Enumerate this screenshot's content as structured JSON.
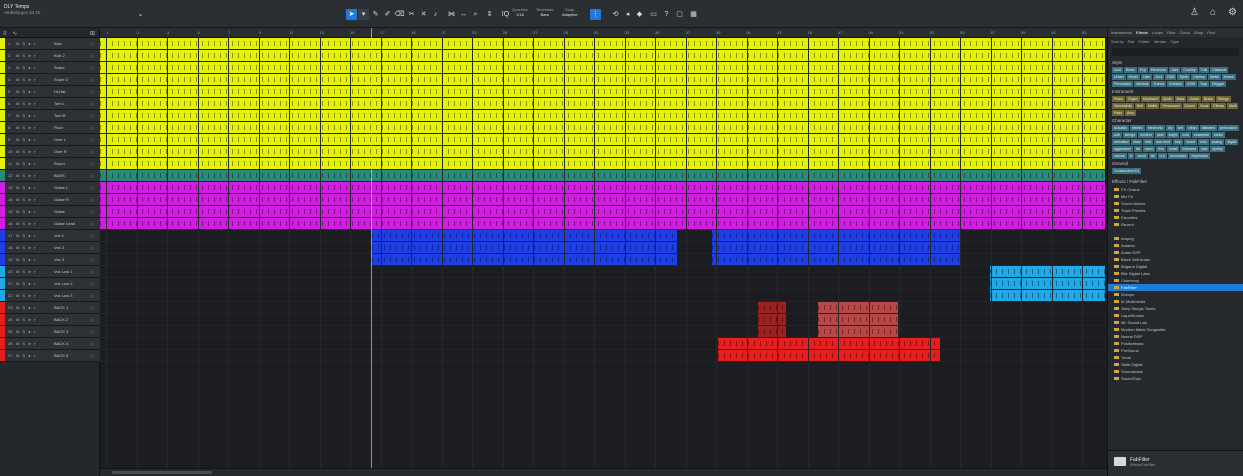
{
  "song": {
    "title": "DLY Temps",
    "file": "Ambvity.gcs",
    "rate": "44.1k"
  },
  "toolbar": {
    "quantize_label": "Quantize",
    "quantize_value": "1/16",
    "timebase_label": "Timebase",
    "timebase_value": "Bars",
    "snap_label": "Snap",
    "snap_value": "Adaptive"
  },
  "colors": {
    "yellow": "#e4f20a",
    "teal": "#2a8a7a",
    "magenta": "#d21ee0",
    "blue": "#1f3fe6",
    "cyan": "#23a8e6",
    "red": "#e61e1e",
    "darkred": "#c23030"
  },
  "ruler": [
    "1",
    "2",
    "3",
    "5",
    "7",
    "9",
    "11",
    "13",
    "15",
    "17",
    "19",
    "21",
    "23",
    "25",
    "27",
    "29",
    "31",
    "33",
    "35",
    "37",
    "39",
    "41",
    "43",
    "45",
    "47",
    "49",
    "51",
    "53",
    "55",
    "57",
    "59",
    "61",
    "63"
  ],
  "tracks": [
    {
      "n": "1",
      "name": "Kick",
      "color": "yellow"
    },
    {
      "n": "2",
      "name": "Kick 2",
      "color": "yellow"
    },
    {
      "n": "3",
      "name": "Snare",
      "color": "yellow"
    },
    {
      "n": "4",
      "name": "Snare 2",
      "color": "yellow"
    },
    {
      "n": "5",
      "name": "Hi-Hat",
      "color": "yellow"
    },
    {
      "n": "6",
      "name": "Tom L",
      "color": "yellow"
    },
    {
      "n": "7",
      "name": "Tom R",
      "color": "yellow"
    },
    {
      "n": "8",
      "name": "Floor",
      "color": "yellow"
    },
    {
      "n": "9",
      "name": "Over L",
      "color": "yellow"
    },
    {
      "n": "10",
      "name": "Over R",
      "color": "yellow"
    },
    {
      "n": "11",
      "name": "Room",
      "color": "yellow"
    },
    {
      "n": "12",
      "name": "BASS",
      "color": "teal"
    },
    {
      "n": "13",
      "name": "Guitar L",
      "color": "magenta"
    },
    {
      "n": "14",
      "name": "Guitar R",
      "color": "magenta"
    },
    {
      "n": "15",
      "name": "Guitar",
      "color": "magenta"
    },
    {
      "n": "16",
      "name": "Guitar Lead",
      "color": "magenta"
    },
    {
      "n": "17",
      "name": "Vox 1",
      "color": "blue"
    },
    {
      "n": "18",
      "name": "Vox 2",
      "color": "blue"
    },
    {
      "n": "19",
      "name": "Vox 3",
      "color": "blue"
    },
    {
      "n": "20",
      "name": "Vox Low 1",
      "color": "cyan"
    },
    {
      "n": "21",
      "name": "Vox Low 2",
      "color": "cyan"
    },
    {
      "n": "22",
      "name": "Vox Low 3",
      "color": "cyan"
    },
    {
      "n": "23",
      "name": "BACK 1",
      "color": "red"
    },
    {
      "n": "24",
      "name": "BACK 2",
      "color": "red"
    },
    {
      "n": "25",
      "name": "BACK 3",
      "color": "red"
    },
    {
      "n": "26",
      "name": "BACK 4",
      "color": "red"
    },
    {
      "n": "27",
      "name": "BACK 5",
      "color": "red"
    }
  ],
  "browser": {
    "tabs": [
      "Instruments",
      "Effects",
      "Loops",
      "Files",
      "Cloud",
      "Shop",
      "Pool"
    ],
    "subtabs": [
      "Sort by",
      "Flat",
      "Folder",
      "Vendor",
      "Type"
    ],
    "style_label": "Style",
    "style_tags": [
      "Acid",
      "Blues",
      "Pop",
      "Electronic",
      "Jazz",
      "Country",
      "Folk",
      "Classical",
      "Urban",
      "World",
      "Latin",
      "Soul",
      "R&B",
      "Synth",
      "HipHop",
      "Metal",
      "House",
      "Percussion",
      "Minimal",
      "Trance",
      "Dubstep",
      "EDM",
      "Trap",
      "Reggae"
    ],
    "instrument_label": "Instrument",
    "instrument_tags": [
      "Piano",
      "Organ",
      "Keyboard",
      "Synth",
      "Bass",
      "Guitar",
      "Brass",
      "Strings",
      "Woodwinds",
      "Bell",
      "Mallet",
      "Percussion",
      "Drums",
      "Vocal",
      "Effects",
      "Multi",
      "Pads",
      "Arco"
    ],
    "character_label": "Character",
    "character_tags": [
      "acoustic",
      "electric",
      "electronic",
      "dry",
      "wet",
      "clean",
      "distorted",
      "percussive",
      "soft",
      "strings",
      "modern",
      "dark",
      "bright",
      "cold",
      "ensemble",
      "metal",
      "animated",
      "slow",
      "fast",
      "one-shot",
      "loop",
      "drone",
      "solo",
      "analog",
      "digital",
      "aggressive",
      "fat",
      "warm",
      "thin",
      "small",
      "hollowed",
      "lush",
      "synthy",
      "natural",
      "fx",
      "vocal",
      "fat",
      "lo-fi",
      "processed",
      "expressive"
    ],
    "general_label": "General",
    "general_tags": [
      "Construction Kit"
    ],
    "effects_label": "Effects  /  FabFilter",
    "folders": [
      "FX Chains",
      "Mix FX",
      "Sound Advice",
      "Track Presets",
      "Favorites",
      "Recent",
      "",
      "Ampeg",
      "Antares",
      "Audio DSP",
      "Black Salt Audio",
      "Brigand Digital",
      "Bitz Digital Labs",
      "Celemony",
      "FabFilter",
      "iZotope",
      "IK Multimedia",
      "Jixey Sturgis Tones",
      "LiquidSonics",
      "ML Sound Lab",
      "Modern Metal Songwriter",
      "Neural DSP",
      "Positivebass",
      "PreSonus",
      "Tonal",
      "Slate Digital",
      "Soundworks",
      "SoundToys"
    ],
    "selected_folder": "FabFilter",
    "footer_title": "FabFilter",
    "footer_sub": "Effects/FabFilter"
  }
}
